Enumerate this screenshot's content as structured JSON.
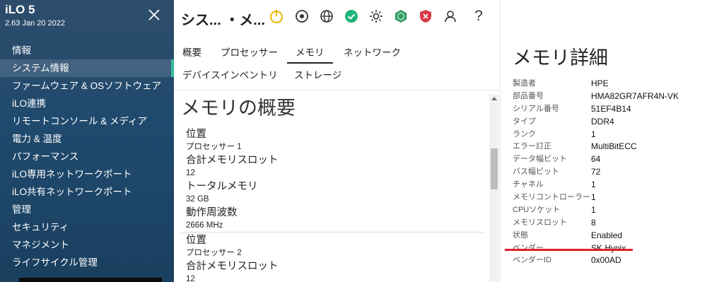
{
  "sidebar": {
    "brand": "iLO 5",
    "version": "2.63 Jan 20 2022",
    "close_icon": "close-icon",
    "items": [
      {
        "label": "情報"
      },
      {
        "label": "システム情報",
        "active": true
      },
      {
        "label": "ファームウェア & OSソフトウェア"
      },
      {
        "label": "iLO連携"
      },
      {
        "label": "リモートコンソール & メディア"
      },
      {
        "label": "電力 & 温度"
      },
      {
        "label": "パフォーマンス"
      },
      {
        "label": "iLO専用ネットワークポート"
      },
      {
        "label": "iLO共有ネットワークポート"
      },
      {
        "label": "管理"
      },
      {
        "label": "セキュリティ"
      },
      {
        "label": "マネジメント"
      },
      {
        "label": "ライフサイクル管理"
      }
    ]
  },
  "header": {
    "title": "シス... ・メ...",
    "icons": [
      "power-icon",
      "target-icon",
      "globe-icon",
      "health-ok-icon",
      "brightness-icon",
      "hexagon-status-icon",
      "shield-icon",
      "user-icon",
      "help-icon"
    ],
    "help_glyph": "?"
  },
  "tabs": {
    "items": [
      "概要",
      "プロセッサー",
      "メモリ",
      "ネットワーク",
      "デバイスインベントリ",
      "ストレージ"
    ],
    "active": "メモリ"
  },
  "overview": {
    "title": "メモリの概要",
    "processors": [
      {
        "location_label": "位置",
        "location_value": "プロセッサー 1",
        "slots_label": "合計メモリスロット",
        "slots_value": "12",
        "total_label": "トータルメモリ",
        "total_value": "32 GB",
        "freq_label": "動作周波数",
        "freq_value": "2666 MHz"
      },
      {
        "location_label": "位置",
        "location_value": "プロセッサー 2",
        "slots_label": "合計メモリスロット",
        "slots_value": "12"
      }
    ]
  },
  "detail": {
    "title": "メモリ詳細",
    "rows": [
      {
        "key": "製造者",
        "value": "HPE"
      },
      {
        "key": "部品番号",
        "value": "HMA82GR7AFR4N-VK"
      },
      {
        "key": "シリアル番号",
        "value": "51EF4B14"
      },
      {
        "key": "タイプ",
        "value": "DDR4"
      },
      {
        "key": "ランク",
        "value": "1"
      },
      {
        "key": "エラー訂正",
        "value": "MultiBitECC"
      },
      {
        "key": "データ幅ビット",
        "value": "64"
      },
      {
        "key": "バス幅ビット",
        "value": "72"
      },
      {
        "key": "チャネル",
        "value": "1"
      },
      {
        "key": "メモリコントローラー",
        "value": "1"
      },
      {
        "key": "CPUソケット",
        "value": "1"
      },
      {
        "key": "メモリスロット",
        "value": "8"
      },
      {
        "key": "状態",
        "value": "Enabled"
      },
      {
        "key": "ベンダー",
        "value": "SK Hynix"
      },
      {
        "key": "ベンダーID",
        "value": "0x00AD"
      }
    ],
    "highlight_color": "#e0202c"
  },
  "colors": {
    "sidebar_bg": "#1f4a6d",
    "active_indicator": "#2fbf9b",
    "power_icon": "#e6b800",
    "health_ok": "#1fb37a",
    "hexagon_status": "#2e9a62",
    "shield": "#d63a45"
  }
}
